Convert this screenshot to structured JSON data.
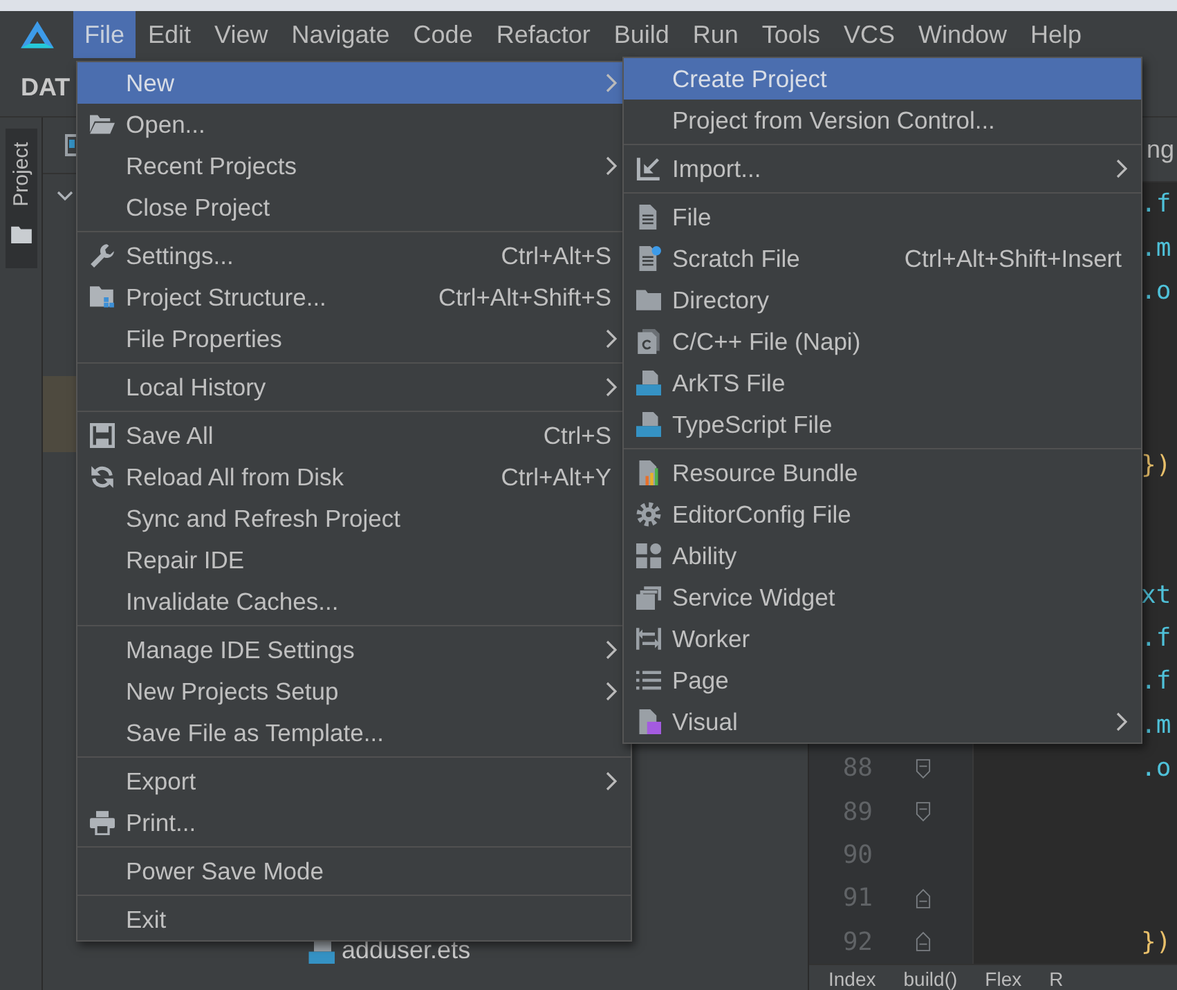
{
  "menubar": {
    "items": [
      {
        "label": "File",
        "selected": true
      },
      {
        "label": "Edit",
        "selected": false
      },
      {
        "label": "View",
        "selected": false
      },
      {
        "label": "Navigate",
        "selected": false
      },
      {
        "label": "Code",
        "selected": false
      },
      {
        "label": "Refactor",
        "selected": false
      },
      {
        "label": "Build",
        "selected": false
      },
      {
        "label": "Run",
        "selected": false
      },
      {
        "label": "Tools",
        "selected": false
      },
      {
        "label": "VCS",
        "selected": false
      },
      {
        "label": "Window",
        "selected": false
      },
      {
        "label": "Help",
        "selected": false
      }
    ]
  },
  "toolbar": {
    "title": "DAT"
  },
  "tool_strip": {
    "label": "Project"
  },
  "project_panel": {
    "files": [
      {
        "name": "adduser.ets"
      }
    ]
  },
  "editor": {
    "tab": "ng",
    "lines": [
      {
        "code": ".f",
        "kind": "call"
      },
      {
        "code": ".m",
        "kind": "call"
      },
      {
        "code": ".o",
        "kind": "call"
      },
      {
        "kind": "blank"
      },
      {
        "kind": "blank"
      },
      {
        "kind": "blank"
      },
      {
        "code": "})",
        "kind": "brace"
      },
      {
        "kind": "blank"
      },
      {
        "kind": "blank"
      },
      {
        "code": "xt",
        "kind": "call"
      },
      {
        "code": ".f",
        "kind": "call"
      },
      {
        "code": ".f",
        "kind": "call"
      },
      {
        "code": ".m",
        "kind": "call"
      },
      {
        "number": "88",
        "code": ".o",
        "kind": "call",
        "fold_start": true,
        "fold_end": false
      },
      {
        "number": "89",
        "fold_start": true,
        "fold_end": false
      },
      {
        "number": "90",
        "fold_start": false,
        "fold_end": false
      },
      {
        "number": "91",
        "fold_start": false,
        "fold_end": true
      },
      {
        "number": "92",
        "code": "})",
        "kind": "brace",
        "fold_start": false,
        "fold_end": true
      }
    ]
  },
  "breadcrumb": [
    "Index",
    "build()",
    "Flex",
    "R"
  ],
  "file_menu": {
    "groups": [
      [
        {
          "label": "New",
          "selected": true,
          "submenu": true
        },
        {
          "label": "Open...",
          "selected": false,
          "submenu": false
        },
        {
          "label": "Recent Projects",
          "selected": false,
          "submenu": true
        },
        {
          "label": "Close Project",
          "selected": false,
          "submenu": false
        }
      ],
      [
        {
          "label": "Settings...",
          "shortcut": "Ctrl+Alt+S",
          "selected": false,
          "submenu": false
        },
        {
          "label": "Project Structure...",
          "shortcut": "Ctrl+Alt+Shift+S",
          "selected": false,
          "submenu": false
        },
        {
          "label": "File Properties",
          "selected": false,
          "submenu": true
        }
      ],
      [
        {
          "label": "Local History",
          "selected": false,
          "submenu": true
        }
      ],
      [
        {
          "label": "Save All",
          "shortcut": "Ctrl+S",
          "selected": false,
          "submenu": false
        },
        {
          "label": "Reload All from Disk",
          "shortcut": "Ctrl+Alt+Y",
          "selected": false,
          "submenu": false
        },
        {
          "label": "Sync and Refresh Project",
          "selected": false,
          "submenu": false
        },
        {
          "label": "Repair IDE",
          "selected": false,
          "submenu": false
        },
        {
          "label": "Invalidate Caches...",
          "selected": false,
          "submenu": false
        }
      ],
      [
        {
          "label": "Manage IDE Settings",
          "selected": false,
          "submenu": true
        },
        {
          "label": "New Projects Setup",
          "selected": false,
          "submenu": true
        },
        {
          "label": "Save File as Template...",
          "selected": false,
          "submenu": false
        }
      ],
      [
        {
          "label": "Export",
          "selected": false,
          "submenu": true
        },
        {
          "label": "Print...",
          "selected": false,
          "submenu": false
        }
      ],
      [
        {
          "label": "Power Save Mode",
          "selected": false,
          "submenu": false
        }
      ],
      [
        {
          "label": "Exit",
          "selected": false,
          "submenu": false
        }
      ]
    ]
  },
  "new_submenu": {
    "groups": [
      [
        {
          "label": "Create Project",
          "selected": true,
          "submenu": false
        },
        {
          "label": "Project from Version Control...",
          "selected": false,
          "submenu": false
        }
      ],
      [
        {
          "label": "Import...",
          "selected": false,
          "submenu": true
        }
      ],
      [
        {
          "label": "File",
          "selected": false,
          "submenu": false
        },
        {
          "label": "Scratch File",
          "shortcut": "Ctrl+Alt+Shift+Insert",
          "selected": false,
          "submenu": false
        },
        {
          "label": "Directory",
          "selected": false,
          "submenu": false
        },
        {
          "label": "C/C++ File (Napi)",
          "selected": false,
          "submenu": false
        },
        {
          "label": "ArkTS File",
          "selected": false,
          "submenu": false
        },
        {
          "label": "TypeScript File",
          "selected": false,
          "submenu": false
        }
      ],
      [
        {
          "label": "Resource Bundle",
          "selected": false,
          "submenu": false
        },
        {
          "label": "EditorConfig File",
          "selected": false,
          "submenu": false
        },
        {
          "label": "Ability",
          "selected": false,
          "submenu": false
        },
        {
          "label": "Service Widget",
          "selected": false,
          "submenu": false
        },
        {
          "label": "Worker",
          "selected": false,
          "submenu": false
        },
        {
          "label": "Page",
          "selected": false,
          "submenu": false
        },
        {
          "label": "Visual",
          "selected": false,
          "submenu": true
        }
      ]
    ]
  }
}
